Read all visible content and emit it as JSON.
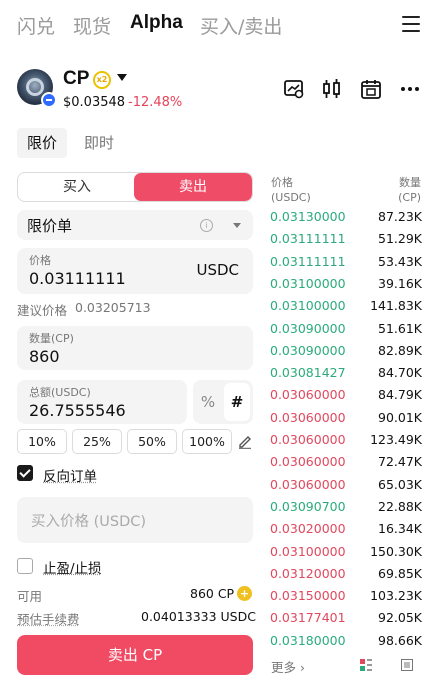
{
  "nav": {
    "tabs": [
      "闪兑",
      "现货",
      "Alpha",
      "买入/卖出"
    ],
    "active_index": 2
  },
  "token": {
    "symbol": "CP",
    "multiplier_badge": "x2",
    "price": "$0.03548",
    "change": "-12.48%"
  },
  "order_type_tabs": {
    "limit": "限价",
    "market": "即时"
  },
  "side_toggle": {
    "buy": "买入",
    "sell": "卖出",
    "active": "sell"
  },
  "order_type_select": {
    "value": "限价单"
  },
  "price_field": {
    "label": "价格",
    "value": "0.03111111",
    "unit": "USDC"
  },
  "suggested": {
    "label": "建议价格",
    "value": "0.03205713"
  },
  "quantity_field": {
    "label": "数量(CP)",
    "value": "860"
  },
  "total_field": {
    "label": "总额(USDC)",
    "value": "26.7555546",
    "pct_symbol": "%",
    "hash_symbol": "#"
  },
  "percent_buttons": [
    "10%",
    "25%",
    "50%",
    "100%"
  ],
  "reverse_order": {
    "label": "反向订单",
    "checked": true
  },
  "trigger_price": {
    "placeholder": "买入价格 (USDC)"
  },
  "tp_sl": {
    "label": "止盈/止损",
    "checked": false
  },
  "available": {
    "label": "可用",
    "value": "860 CP"
  },
  "fee": {
    "label": "预估手续费",
    "value": "0.04013333 USDC"
  },
  "submit": {
    "label": "卖出 CP"
  },
  "order_book": {
    "price_header": "价格",
    "price_unit": "(USDC)",
    "qty_header": "数量",
    "qty_unit": "(CP)",
    "rows": [
      {
        "price": "0.03130000",
        "qty": "87.23K",
        "side": "buy"
      },
      {
        "price": "0.03111111",
        "qty": "51.29K",
        "side": "buy"
      },
      {
        "price": "0.03111111",
        "qty": "53.43K",
        "side": "buy"
      },
      {
        "price": "0.03100000",
        "qty": "39.16K",
        "side": "buy"
      },
      {
        "price": "0.03100000",
        "qty": "141.83K",
        "side": "buy"
      },
      {
        "price": "0.03090000",
        "qty": "51.61K",
        "side": "buy"
      },
      {
        "price": "0.03090000",
        "qty": "82.89K",
        "side": "buy"
      },
      {
        "price": "0.03081427",
        "qty": "84.70K",
        "side": "buy"
      },
      {
        "price": "0.03060000",
        "qty": "84.79K",
        "side": "sell"
      },
      {
        "price": "0.03060000",
        "qty": "90.01K",
        "side": "sell"
      },
      {
        "price": "0.03060000",
        "qty": "123.49K",
        "side": "sell"
      },
      {
        "price": "0.03060000",
        "qty": "72.47K",
        "side": "sell"
      },
      {
        "price": "0.03060000",
        "qty": "65.03K",
        "side": "sell"
      },
      {
        "price": "0.03090700",
        "qty": "22.88K",
        "side": "buy"
      },
      {
        "price": "0.03020000",
        "qty": "16.34K",
        "side": "sell"
      },
      {
        "price": "0.03100000",
        "qty": "150.30K",
        "side": "sell"
      },
      {
        "price": "0.03120000",
        "qty": "69.85K",
        "side": "sell"
      },
      {
        "price": "0.03150000",
        "qty": "103.23K",
        "side": "sell"
      },
      {
        "price": "0.03177401",
        "qty": "92.05K",
        "side": "sell"
      },
      {
        "price": "0.03180000",
        "qty": "98.66K",
        "side": "buy"
      }
    ],
    "more_label": "更多 ›"
  },
  "colors": {
    "sell": "#ef4d67",
    "buy_price": "#2bab7c",
    "sell_price": "#e0485e"
  },
  "icons": [
    "menu-icon",
    "chart-settings-icon",
    "candlestick-icon",
    "calendar-icon",
    "more-icon",
    "info-icon",
    "chevron-down-icon",
    "pencil-icon",
    "coin-icon",
    "layout-icon"
  ]
}
